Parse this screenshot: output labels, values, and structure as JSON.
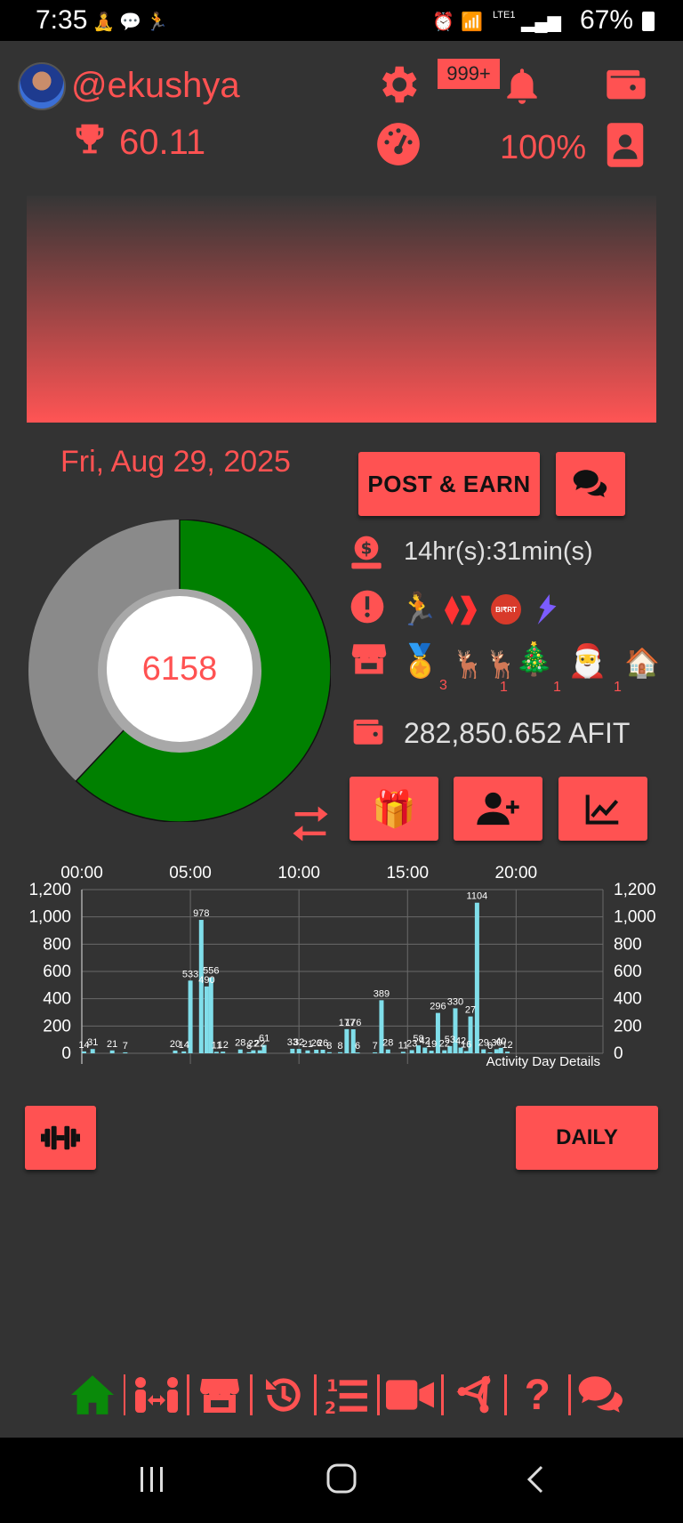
{
  "status_bar": {
    "time": "7:35",
    "battery": "67%",
    "network": "LTE1"
  },
  "profile": {
    "username": "@ekushya",
    "score": "60.11",
    "notifications_badge": "999+",
    "percent": "100%"
  },
  "date": "Fri, Aug 29, 2025",
  "buttons": {
    "post_earn": "POST & EARN",
    "daily": "DAILY"
  },
  "info": {
    "timer": "14hr(s):31min(s)",
    "balance": "282,850.652 AFIT"
  },
  "steps": {
    "value": "6158",
    "progress_fraction": 0.62
  },
  "badges": [
    {
      "icon": "medal-icon",
      "count": "3"
    },
    {
      "icon": "reindeer-icon",
      "count": "1"
    },
    {
      "icon": "christmas-tree-icon",
      "count": "1"
    },
    {
      "icon": "santa-icon",
      "count": "1"
    },
    {
      "icon": "santa-chimney-icon",
      "count": ""
    }
  ],
  "colors": {
    "accent": "#ff5252",
    "background": "#333333",
    "progress": "#008000",
    "remaining": "#8a8a8a",
    "bars": "#80deea"
  },
  "chart_data": {
    "type": "bar",
    "title": "",
    "note": "Activity Day Details",
    "x_ticks": [
      "00:00",
      "05:00",
      "10:00",
      "15:00",
      "20:00"
    ],
    "y_ticks": [
      "0",
      "200",
      "400",
      "600",
      "800",
      "1,000",
      "1,200"
    ],
    "ylim": [
      0,
      1200
    ],
    "xlim_hours": [
      0,
      24
    ],
    "grid": true,
    "bars": [
      {
        "t": 0.1,
        "v": 14,
        "label": "14"
      },
      {
        "t": 0.5,
        "v": 31,
        "label": "31"
      },
      {
        "t": 1.4,
        "v": 21,
        "label": "21"
      },
      {
        "t": 2.0,
        "v": 7,
        "label": "7"
      },
      {
        "t": 4.3,
        "v": 20,
        "label": "20"
      },
      {
        "t": 4.7,
        "v": 14,
        "label": "14"
      },
      {
        "t": 5.0,
        "v": 533,
        "label": "533"
      },
      {
        "t": 5.5,
        "v": 978,
        "label": "978"
      },
      {
        "t": 5.75,
        "v": 490,
        "label": "490"
      },
      {
        "t": 5.95,
        "v": 556,
        "label": "556"
      },
      {
        "t": 6.2,
        "v": 11,
        "label": "11"
      },
      {
        "t": 6.5,
        "v": 12,
        "label": "12"
      },
      {
        "t": 7.3,
        "v": 28,
        "label": "28"
      },
      {
        "t": 7.7,
        "v": 8,
        "label": "8"
      },
      {
        "t": 7.9,
        "v": 22,
        "label": "22"
      },
      {
        "t": 8.2,
        "v": 22,
        "label": "22"
      },
      {
        "t": 8.4,
        "v": 61,
        "label": "61"
      },
      {
        "t": 9.7,
        "v": 33,
        "label": "33"
      },
      {
        "t": 10.0,
        "v": 32,
        "label": "32"
      },
      {
        "t": 10.4,
        "v": 21,
        "label": "21"
      },
      {
        "t": 10.8,
        "v": 26,
        "label": "26"
      },
      {
        "t": 11.1,
        "v": 26,
        "label": "26"
      },
      {
        "t": 11.4,
        "v": 8,
        "label": "8"
      },
      {
        "t": 11.9,
        "v": 8,
        "label": "8"
      },
      {
        "t": 12.2,
        "v": 177,
        "label": "177"
      },
      {
        "t": 12.5,
        "v": 176,
        "label": "176"
      },
      {
        "t": 12.7,
        "v": 6,
        "label": "6"
      },
      {
        "t": 13.5,
        "v": 7,
        "label": "7"
      },
      {
        "t": 13.8,
        "v": 389,
        "label": "389"
      },
      {
        "t": 14.1,
        "v": 28,
        "label": "28"
      },
      {
        "t": 14.8,
        "v": 11,
        "label": "11"
      },
      {
        "t": 15.2,
        "v": 23,
        "label": "23"
      },
      {
        "t": 15.5,
        "v": 58,
        "label": "58"
      },
      {
        "t": 15.8,
        "v": 42,
        "label": "42"
      },
      {
        "t": 16.1,
        "v": 19,
        "label": "19"
      },
      {
        "t": 16.4,
        "v": 296,
        "label": "296"
      },
      {
        "t": 16.7,
        "v": 22,
        "label": "22"
      },
      {
        "t": 16.95,
        "v": 53,
        "label": "53"
      },
      {
        "t": 17.2,
        "v": 330,
        "label": "330"
      },
      {
        "t": 17.45,
        "v": 42,
        "label": "42"
      },
      {
        "t": 17.7,
        "v": 16,
        "label": "16"
      },
      {
        "t": 17.9,
        "v": 270,
        "label": "27"
      },
      {
        "t": 18.2,
        "v": 1104,
        "label": "1104"
      },
      {
        "t": 18.5,
        "v": 29,
        "label": "29"
      },
      {
        "t": 18.8,
        "v": 6,
        "label": "6"
      },
      {
        "t": 19.1,
        "v": 30,
        "label": "30"
      },
      {
        "t": 19.3,
        "v": 40,
        "label": "40"
      },
      {
        "t": 19.6,
        "v": 12,
        "label": "12"
      }
    ]
  }
}
